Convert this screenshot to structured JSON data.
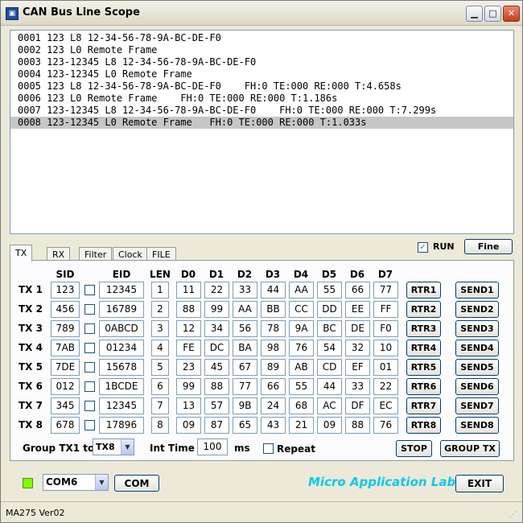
{
  "window": {
    "title": "CAN Bus Line Scope",
    "minimize": "▁",
    "maximize": "□",
    "close": "✕",
    "app_icon": "CAN"
  },
  "log": [
    "0001 123 L8 12-34-56-78-9A-BC-DE-F0",
    "0002 123 L0 Remote Frame",
    "0003 123-12345 L8 12-34-56-78-9A-BC-DE-F0",
    "0004 123-12345 L0 Remote Frame",
    "0005 123 L8 12-34-56-78-9A-BC-DE-F0    FH:0 TE:000 RE:000 T:4.658s",
    "0006 123 L0 Remote Frame    FH:0 TE:000 RE:000 T:1.186s",
    "0007 123-12345 L8 12-34-56-78-9A-BC-DE-F0    FH:0 TE:000 RE:000 T:7.299s",
    "0008 123-12345 L0 Remote Frame   FH:0 TE:000 RE:000 T:1.033s"
  ],
  "tabs": [
    "TX",
    "RX",
    "Filter",
    "Clock",
    "FILE"
  ],
  "run": {
    "label": "RUN",
    "checked": "✓"
  },
  "fine_button": "Fine",
  "headers": [
    "SID",
    "EID",
    "LEN",
    "D0",
    "D1",
    "D2",
    "D3",
    "D4",
    "D5",
    "D6",
    "D7"
  ],
  "tx_rows": [
    {
      "label": "TX 1",
      "sid": "123",
      "eid": "12345",
      "len": "1",
      "d": [
        "11",
        "22",
        "33",
        "44",
        "AA",
        "55",
        "66",
        "77"
      ],
      "rtr": "RTR1",
      "send": "SEND1"
    },
    {
      "label": "TX 2",
      "sid": "456",
      "eid": "16789",
      "len": "2",
      "d": [
        "88",
        "99",
        "AA",
        "BB",
        "CC",
        "DD",
        "EE",
        "FF"
      ],
      "rtr": "RTR2",
      "send": "SEND2"
    },
    {
      "label": "TX 3",
      "sid": "789",
      "eid": "0ABCD",
      "len": "3",
      "d": [
        "12",
        "34",
        "56",
        "78",
        "9A",
        "BC",
        "DE",
        "F0"
      ],
      "rtr": "RTR3",
      "send": "SEND3"
    },
    {
      "label": "TX 4",
      "sid": "7AB",
      "eid": "01234",
      "len": "4",
      "d": [
        "FE",
        "DC",
        "BA",
        "98",
        "76",
        "54",
        "32",
        "10"
      ],
      "rtr": "RTR4",
      "send": "SEND4"
    },
    {
      "label": "TX 5",
      "sid": "7DE",
      "eid": "15678",
      "len": "5",
      "d": [
        "23",
        "45",
        "67",
        "89",
        "AB",
        "CD",
        "EF",
        "01"
      ],
      "rtr": "RTR5",
      "send": "SEND5"
    },
    {
      "label": "TX 6",
      "sid": "012",
      "eid": "1BCDE",
      "len": "6",
      "d": [
        "99",
        "88",
        "77",
        "66",
        "55",
        "44",
        "33",
        "22"
      ],
      "rtr": "RTR6",
      "send": "SEND6"
    },
    {
      "label": "TX 7",
      "sid": "345",
      "eid": "12345",
      "len": "7",
      "d": [
        "13",
        "57",
        "9B",
        "24",
        "68",
        "AC",
        "DF",
        "EC"
      ],
      "rtr": "RTR7",
      "send": "SEND7"
    },
    {
      "label": "TX 8",
      "sid": "678",
      "eid": "17896",
      "len": "8",
      "d": [
        "09",
        "87",
        "65",
        "43",
        "21",
        "09",
        "88",
        "76"
      ],
      "rtr": "RTR8",
      "send": "SEND8"
    }
  ],
  "group": {
    "label": "Group TX1 to",
    "selected": "TX8"
  },
  "int_time": {
    "label": "Int Time",
    "value": "100",
    "unit": "ms"
  },
  "repeat_label": "Repeat",
  "stop_button": "STOP",
  "group_tx_button": "GROUP TX",
  "com": {
    "selected": "COM6",
    "button": "COM"
  },
  "brand": "Micro Application Lab",
  "exit_button": "EXIT",
  "status": "MA275 Ver02",
  "colors": {
    "led": "#7fff00",
    "brand": "#10c8ea",
    "selected_row": "#c6c6c8"
  }
}
